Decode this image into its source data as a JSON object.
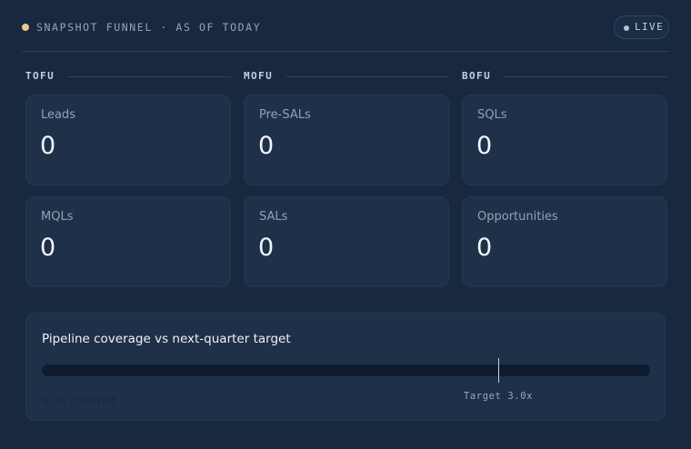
{
  "header": {
    "title": "SNAPSHOT FUNNEL · AS OF TODAY",
    "live_label": "LIVE",
    "accent_color": "#e9c988"
  },
  "stages": [
    {
      "label": "TOFU",
      "metrics": [
        {
          "label": "Leads",
          "value": "0"
        },
        {
          "label": "MQLs",
          "value": "0"
        }
      ]
    },
    {
      "label": "MOFU",
      "metrics": [
        {
          "label": "Pre-SALs",
          "value": "0"
        },
        {
          "label": "SALs",
          "value": "0"
        }
      ]
    },
    {
      "label": "BOFU",
      "metrics": [
        {
          "label": "SQLs",
          "value": "0"
        },
        {
          "label": "Opportunities",
          "value": "0"
        }
      ]
    }
  ],
  "coverage": {
    "title": "Pipeline coverage vs next-quarter target",
    "coverage_value": 0.0,
    "target_value": 3.0,
    "scale_max": 4.0,
    "target_label": "Target 3.0x",
    "covered_label": "0.0x covered"
  }
}
